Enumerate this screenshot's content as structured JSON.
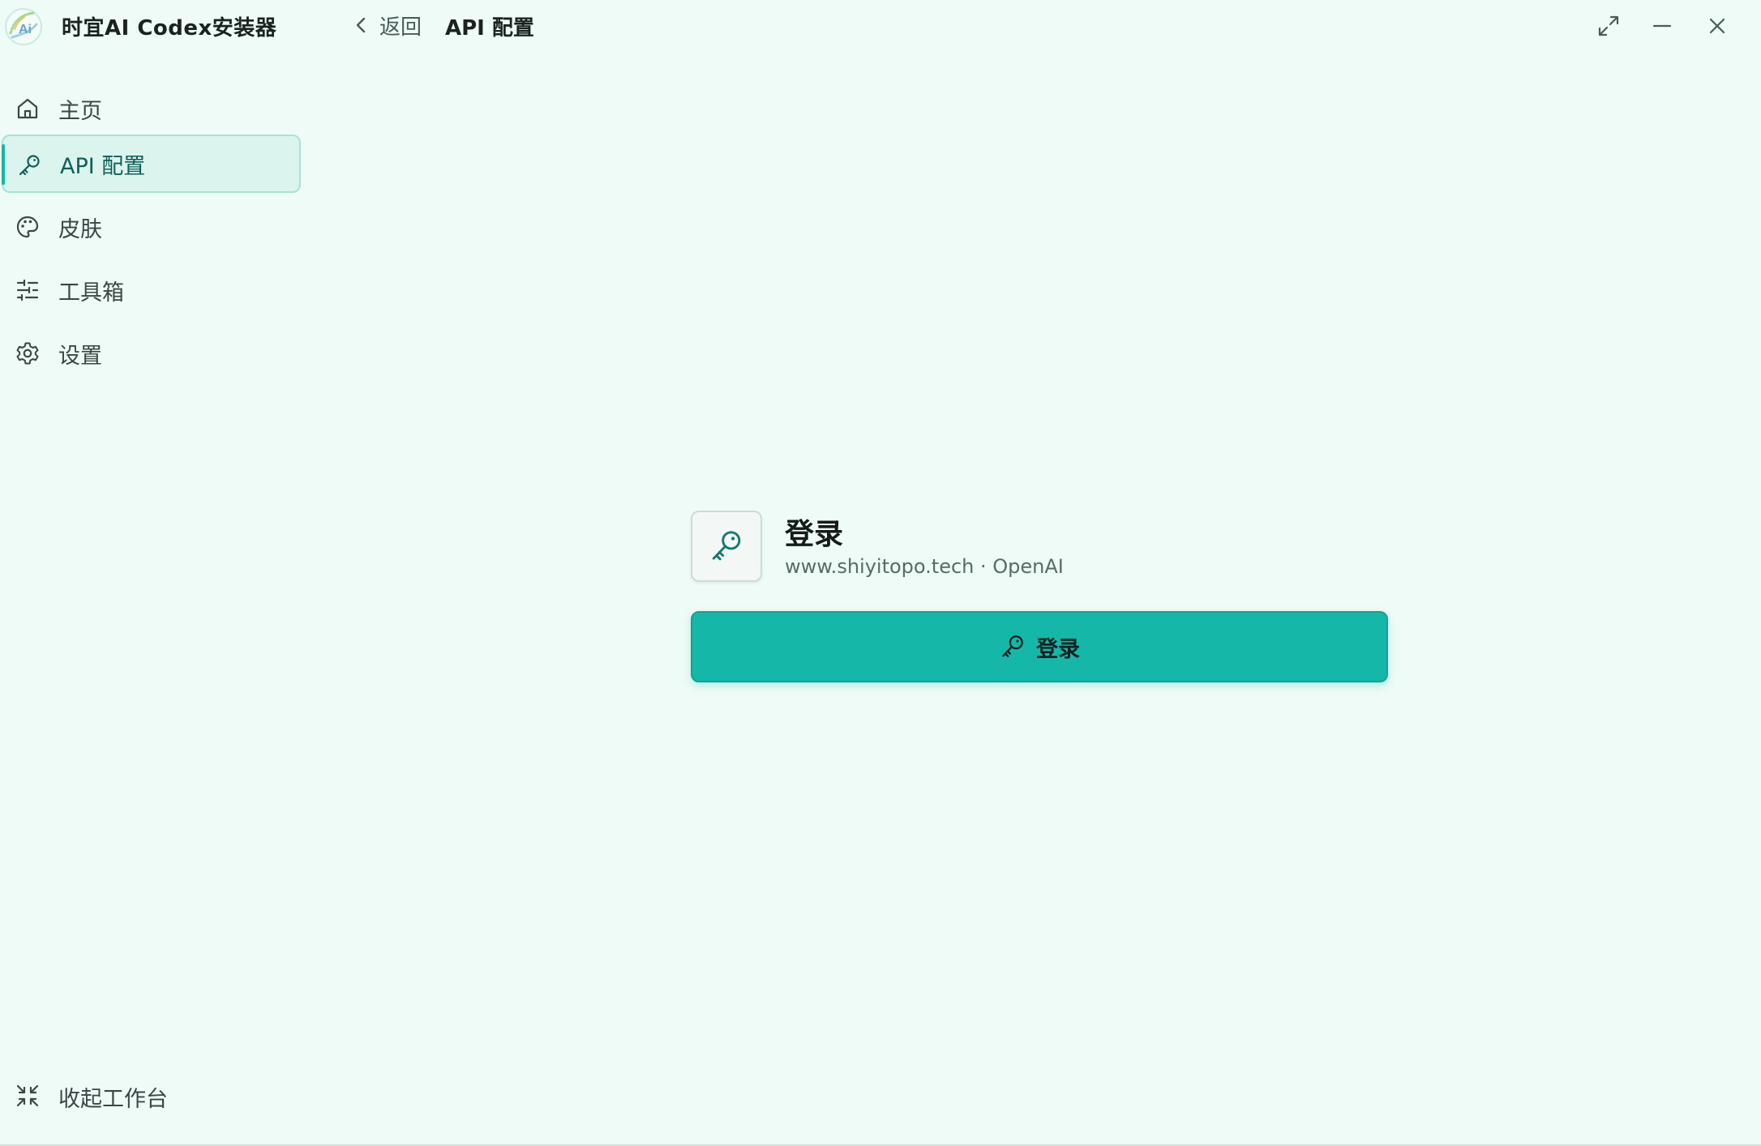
{
  "app": {
    "title": "时宜AI Codex安装器"
  },
  "header": {
    "back_label": "返回",
    "page_title": "API 配置"
  },
  "sidebar": {
    "items": [
      {
        "label": "主页",
        "icon": "home-icon"
      },
      {
        "label": "API 配置",
        "icon": "key-icon",
        "active": true
      },
      {
        "label": "皮肤",
        "icon": "palette-icon"
      },
      {
        "label": "工具箱",
        "icon": "sliders-icon"
      },
      {
        "label": "设置",
        "icon": "gear-icon"
      }
    ],
    "collapse_label": "收起工作台"
  },
  "main": {
    "provider": {
      "name": "登录",
      "subtitle": "www.shiyitopo.tech · OpenAI"
    },
    "login_button_label": "登录"
  },
  "colors": {
    "background": "#eefbf7",
    "accent": "#15b8a8",
    "active_item_bg": "#dbf4ee"
  }
}
